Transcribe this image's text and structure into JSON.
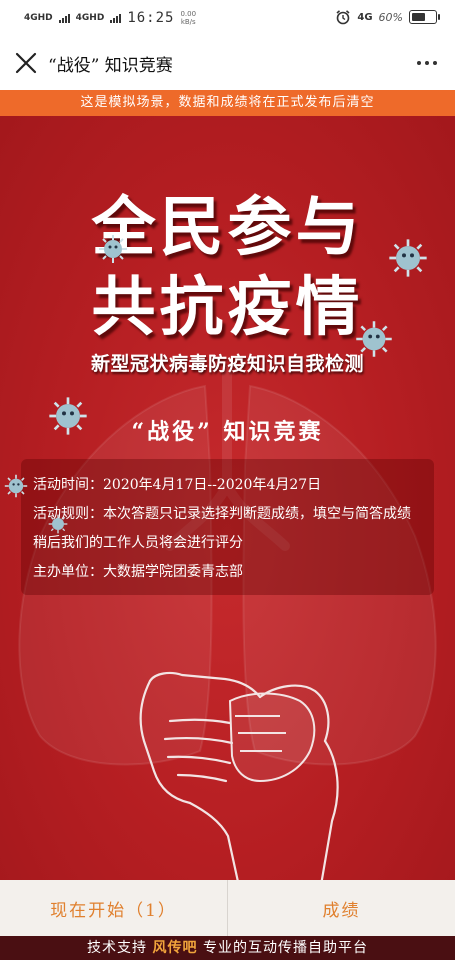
{
  "status_bar": {
    "network1": "4GHD",
    "network2": "4GHD",
    "time": "16:25",
    "net_speed_value": "0.00",
    "net_speed_unit": "kB/s",
    "network3": "4G",
    "battery_text": "60%",
    "battery_level": 0.6,
    "alarm_icon": "alarm-clock-icon"
  },
  "title_bar": {
    "close_icon": "close-icon",
    "title": "“战役” 知识竞赛",
    "more_icon": "more-dots-icon"
  },
  "notice": "这是模拟场景，数据和成绩将在正式发布后清空",
  "poster": {
    "headline_line1": "全民参与",
    "headline_line2": "共抗疫情",
    "subheadline": "新型冠状病毒防疫知识自我检测",
    "quiz_title": "“战役” 知识竞赛",
    "info": {
      "time": "活动时间：2020年4月17日--2020年4月27日",
      "rules": "活动规则：本次答题只记录选择判断题成绩，填空与简答成绩稍后我们的工作人员将会进行评分",
      "organizer": "主办单位：大数据学院团委青志部"
    }
  },
  "actions": {
    "start_label": "现在开始（1）",
    "score_label": "成绩"
  },
  "footer": {
    "prefix": "技术支持",
    "brand": "风传吧",
    "suffix": "专业的互动传播自助平台"
  },
  "colors": {
    "poster_red": "#b81f23",
    "notice_orange": "#ee6a2a",
    "button_text": "#e0802e",
    "footer_bg": "#4a0f12",
    "brand_orange": "#f2a53c"
  }
}
